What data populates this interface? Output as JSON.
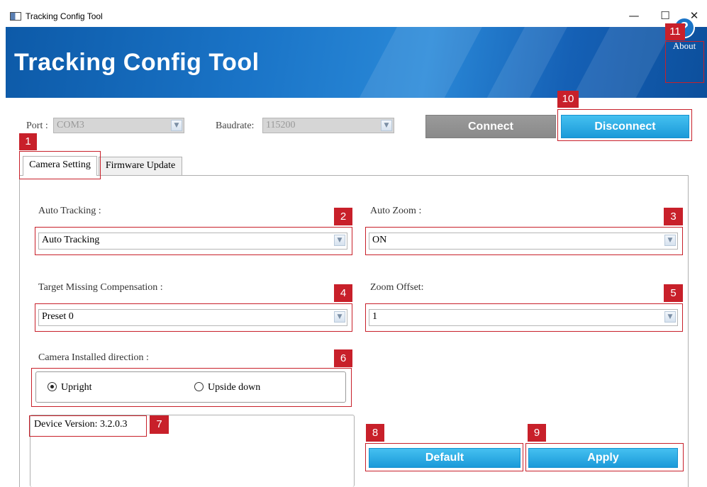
{
  "window": {
    "title": "Tracking Config Tool",
    "controls": {
      "minimize": "—",
      "maximize": "☐",
      "close": "✕"
    }
  },
  "banner": {
    "title": "Tracking Config Tool",
    "about_icon": "?",
    "about_label": "About"
  },
  "connection": {
    "port_label": "Port :",
    "port_value": "COM3",
    "baud_label": "Baudrate:",
    "baud_value": "115200",
    "connect_label": "Connect",
    "disconnect_label": "Disconnect"
  },
  "tabs": [
    {
      "label": "Camera Setting",
      "active": true
    },
    {
      "label": "Firmware Update",
      "active": false
    }
  ],
  "camera_setting": {
    "auto_tracking": {
      "label": "Auto Tracking :",
      "value": "Auto Tracking"
    },
    "auto_zoom": {
      "label": "Auto Zoom :",
      "value": "ON"
    },
    "target_missing": {
      "label": "Target Missing Compensation :",
      "value": "Preset 0"
    },
    "zoom_offset": {
      "label": "Zoom Offset:",
      "value": "1"
    },
    "direction": {
      "label": "Camera Installed direction :",
      "options": [
        {
          "label": "Upright",
          "checked": true
        },
        {
          "label": "Upside down",
          "checked": false
        }
      ]
    },
    "device_version": "Device Version: 3.2.0.3",
    "default_label": "Default",
    "apply_label": "Apply"
  },
  "annotations": [
    "1",
    "2",
    "3",
    "4",
    "5",
    "6",
    "7",
    "8",
    "9",
    "10",
    "11"
  ],
  "colors": {
    "annotation_red": "#c8202a",
    "banner_blue": "#1a74c7",
    "button_blue": "#1a9ad9",
    "button_gray": "#8a8a8a"
  },
  "icons": {
    "app": "app-icon",
    "about": "help-circle-icon",
    "dropdown": "chevron-down-icon"
  }
}
